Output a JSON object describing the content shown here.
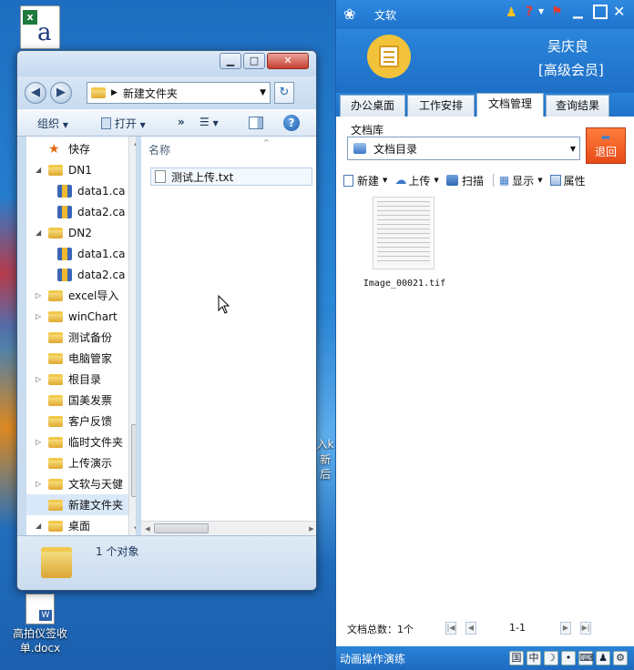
{
  "desktop": {
    "bottom_icon_label_line1": "高拍仪签收",
    "bottom_icon_label_line2": "单.docx",
    "partial_text_1": "入k",
    "partial_text_2": "新后"
  },
  "explorer": {
    "address_path": "新建文件夹",
    "toolbar": {
      "organize": "组织",
      "open": "打开",
      "more": "»"
    },
    "nav_items": [
      {
        "label": "快存",
        "icon": "star",
        "indent": 0,
        "arrow": ""
      },
      {
        "label": "DN1",
        "icon": "folder",
        "indent": 0,
        "arrow": "◢"
      },
      {
        "label": "data1.ca",
        "icon": "db",
        "indent": 1,
        "arrow": ""
      },
      {
        "label": "data2.ca",
        "icon": "db",
        "indent": 1,
        "arrow": ""
      },
      {
        "label": "DN2",
        "icon": "folder",
        "indent": 0,
        "arrow": "◢"
      },
      {
        "label": "data1.ca",
        "icon": "db",
        "indent": 1,
        "arrow": ""
      },
      {
        "label": "data2.ca",
        "icon": "db",
        "indent": 1,
        "arrow": ""
      },
      {
        "label": "excel导入",
        "icon": "folder",
        "indent": 0,
        "arrow": "▷"
      },
      {
        "label": "winChart",
        "icon": "folder",
        "indent": 0,
        "arrow": "▷"
      },
      {
        "label": "测试备份",
        "icon": "folder",
        "indent": 0,
        "arrow": ""
      },
      {
        "label": "电脑管家",
        "icon": "folder",
        "indent": 0,
        "arrow": ""
      },
      {
        "label": "根目录",
        "icon": "folder",
        "indent": 0,
        "arrow": "▷"
      },
      {
        "label": "国美发票",
        "icon": "folder",
        "indent": 0,
        "arrow": ""
      },
      {
        "label": "客户反馈",
        "icon": "folder",
        "indent": 0,
        "arrow": ""
      },
      {
        "label": "临时文件夹",
        "icon": "folder",
        "indent": 0,
        "arrow": "▷"
      },
      {
        "label": "上传演示",
        "icon": "folder",
        "indent": 0,
        "arrow": ""
      },
      {
        "label": "文软与天健",
        "icon": "folder",
        "indent": 0,
        "arrow": "▷"
      },
      {
        "label": "新建文件夹",
        "icon": "folder",
        "indent": 0,
        "arrow": ""
      },
      {
        "label": "桌面",
        "icon": "folder",
        "indent": 0,
        "arrow": "◢"
      }
    ],
    "column_header": "名称",
    "files": [
      {
        "name": "测试上传.txt"
      }
    ],
    "status": "1 个对象"
  },
  "wenruan": {
    "app_title": "文软",
    "user_name": "吴庆良",
    "user_level": "[高级会员]",
    "tabs": [
      "办公桌面",
      "工作安排",
      "文档管理",
      "查询结果"
    ],
    "active_tab": 2,
    "doc_library_label": "文档库",
    "doc_select_value": "文档目录",
    "back_button": "退回",
    "toolbar": {
      "new": "新建",
      "upload": "上传",
      "scan": "扫描",
      "display": "显示",
      "properties": "属性"
    },
    "documents": [
      {
        "name": "Image_00021.tif"
      }
    ],
    "doc_total": "文档总数：1个",
    "page_range": "1-1",
    "bottom_label": "动画操作演练",
    "tray": [
      "国",
      "中",
      "☽",
      "•",
      "⌨",
      "♟",
      "⚙"
    ]
  }
}
